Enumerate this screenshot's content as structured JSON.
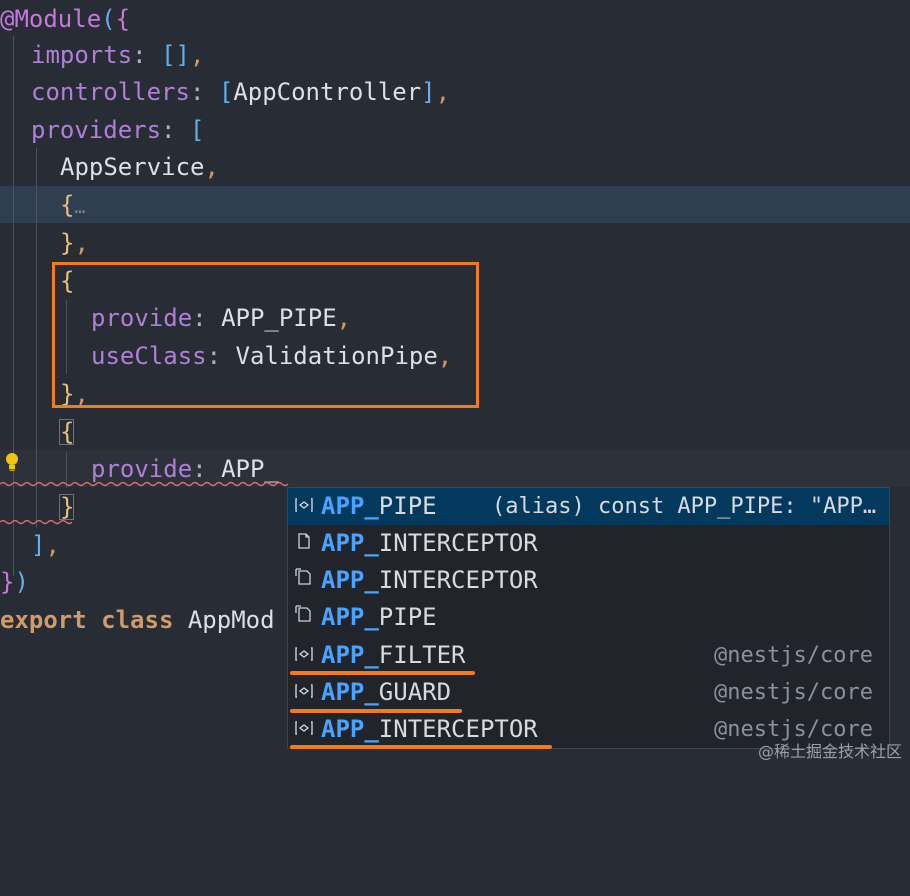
{
  "editor": {
    "decorator": "@Module",
    "open_paren": "(",
    "brace_open": "{",
    "brace_close": "}",
    "close_paren": ")",
    "imports_key": "imports",
    "imports_value": "[]",
    "controllers_key": "controllers",
    "app_controller": "AppController",
    "providers_key": "providers",
    "app_service": "AppService",
    "fold_marker": "…",
    "provide_key": "provide",
    "provide_value": "APP_PIPE",
    "use_class_key": "useClass",
    "use_class_value": "ValidationPipe",
    "typed_value": "APP_",
    "export_keyword": "export",
    "class_keyword": "class",
    "class_name": "AppMod",
    "colon": ":",
    "comma": ",",
    "bracket_open": "[",
    "bracket_close": "]"
  },
  "suggestions": [
    {
      "match": "APP_",
      "rest": "PIPE",
      "icon": "variable-icon",
      "detail": "(alias) const APP_PIPE: \"APP…",
      "source": "",
      "selected": true
    },
    {
      "match": "APP_",
      "rest": "INTERCEPTOR",
      "icon": "file-icon",
      "detail": "",
      "source": "",
      "selected": false
    },
    {
      "match": "APP_",
      "rest": "INTERCEPTOR",
      "icon": "snippet-icon",
      "detail": "",
      "source": "",
      "selected": false
    },
    {
      "match": "APP_",
      "rest": "PIPE",
      "icon": "snippet-icon",
      "detail": "",
      "source": "",
      "selected": false
    },
    {
      "match": "APP_",
      "rest": "FILTER",
      "icon": "variable-icon",
      "detail": "",
      "source": "@nestjs/core",
      "selected": false
    },
    {
      "match": "APP_",
      "rest": "GUARD",
      "icon": "variable-icon",
      "detail": "",
      "source": "@nestjs/core",
      "selected": false
    },
    {
      "match": "APP_",
      "rest": "INTERCEPTOR",
      "icon": "variable-icon",
      "detail": "",
      "source": "@nestjs/core",
      "selected": false
    }
  ],
  "watermark": "@稀土掘金技术社区",
  "colors": {
    "annotation": "#f27b1b",
    "match": "#4aa3ff",
    "selected_bg": "#04395e"
  }
}
